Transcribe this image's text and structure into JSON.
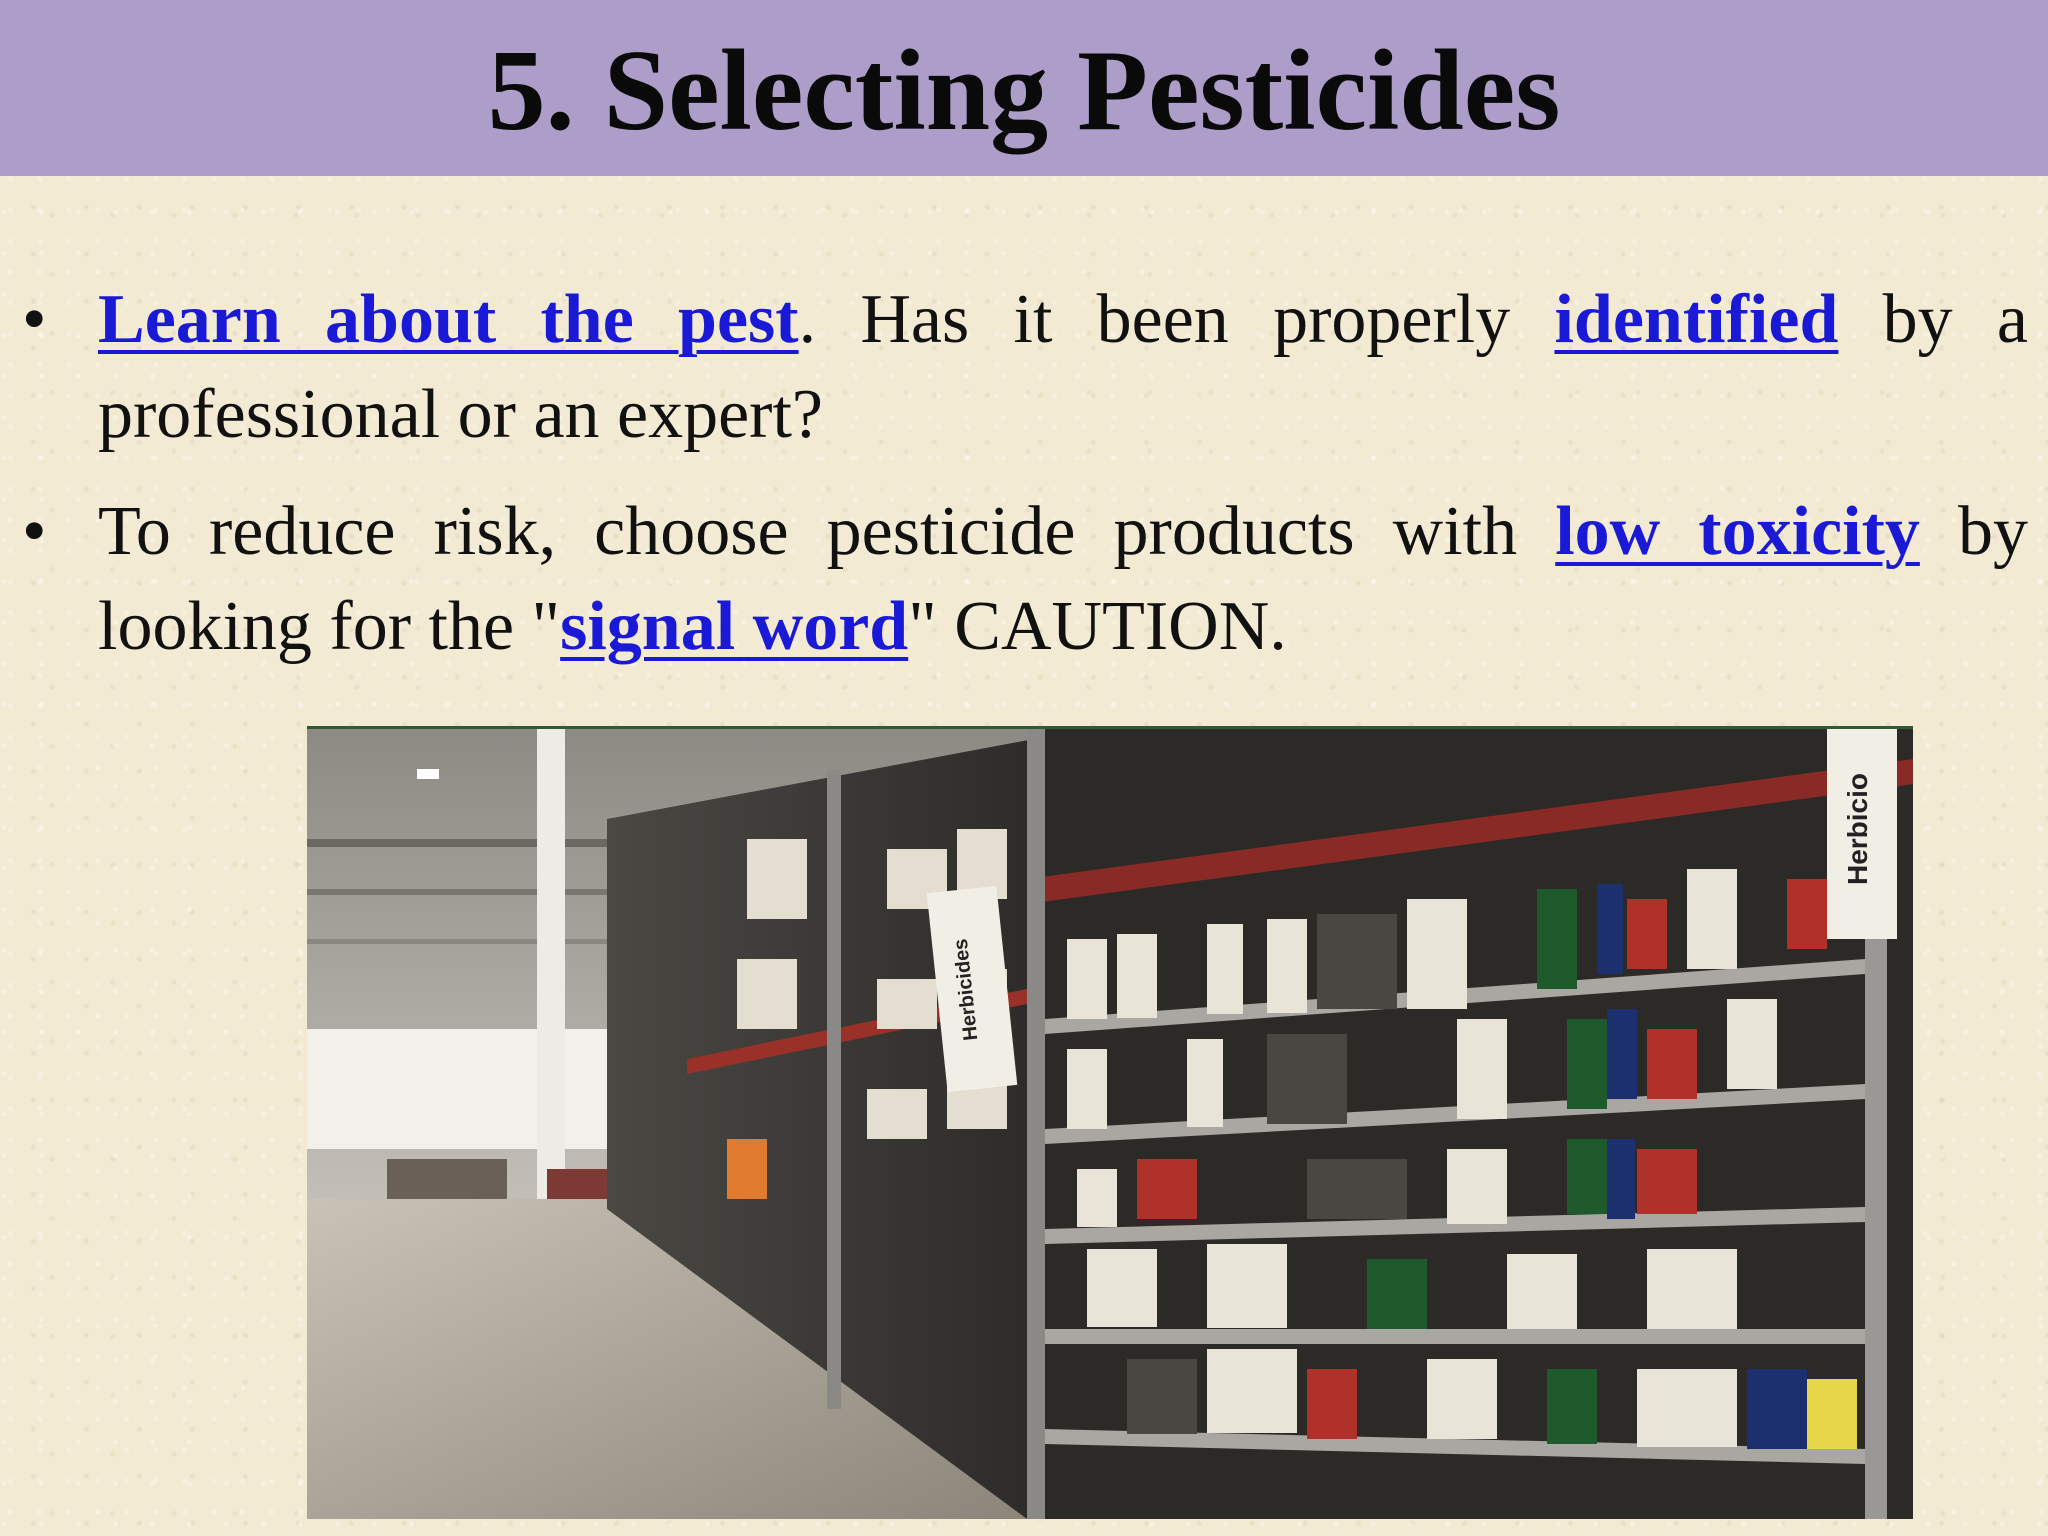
{
  "slide": {
    "title": "5. Selecting Pesticides",
    "accent_color": "#ad9ec9",
    "link_color": "#1a1ad6",
    "bullet_symbol": "•",
    "bullets": [
      {
        "link1": "Learn about the pest",
        "text1": ". Has it been properly ",
        "link2": "identified",
        "text2": " by a professional or an expert?"
      },
      {
        "text1": "To reduce risk, choose pesticide products with ",
        "link1": "low toxicity",
        "text2": " by looking for the \"",
        "link2": "signal word",
        "text3": "\" CAUTION."
      }
    ],
    "photo": {
      "subject": "store aisle with pesticide products on shelves",
      "sign_herbicides": "Herbicides",
      "sign_herbicides_cut": "Herbicio"
    }
  }
}
